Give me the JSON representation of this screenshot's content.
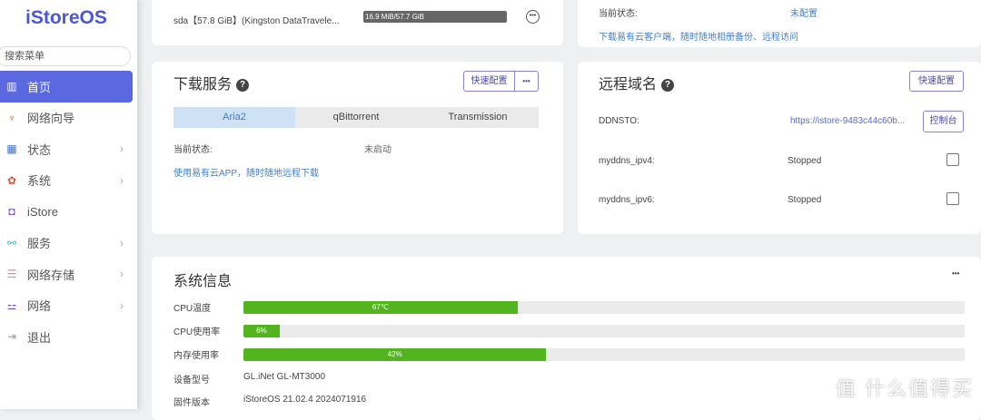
{
  "sidebar": {
    "logo": "iStoreOS",
    "search_placeholder": "搜索菜单",
    "items": [
      {
        "label": "首页",
        "icon": "home-icon",
        "glyph": "▥",
        "color": "#ffffff",
        "chev": ""
      },
      {
        "label": "网络向导",
        "icon": "wizard-icon",
        "glyph": "♆",
        "color": "#e0643b",
        "chev": ""
      },
      {
        "label": "状态",
        "icon": "status-grid-icon",
        "glyph": "▦",
        "color": "#3f6fd8",
        "chev": "›"
      },
      {
        "label": "系统",
        "icon": "gear-icon",
        "glyph": "✿",
        "color": "#e0532f",
        "chev": "›"
      },
      {
        "label": "iStore",
        "icon": "store-bag-icon",
        "glyph": "◘",
        "color": "#7a4fd6",
        "chev": ""
      },
      {
        "label": "服务",
        "icon": "service-icon",
        "glyph": "⚯",
        "color": "#3ab5e0",
        "chev": "›"
      },
      {
        "label": "网络存储",
        "icon": "storage-icon",
        "glyph": "☰",
        "color": "#e58a9a",
        "chev": "›"
      },
      {
        "label": "网络",
        "icon": "network-icon",
        "glyph": "⚍",
        "color": "#6a4fc6",
        "chev": "›"
      },
      {
        "label": "退出",
        "icon": "logout-icon",
        "glyph": "⇥",
        "color": "#999999",
        "chev": ""
      }
    ]
  },
  "disk": {
    "name": "sda【57.8 GiB】(Kingston DataTravele...",
    "usage": "16.9 MiB/57.7 GiB",
    "usage_fraction": 0.0003
  },
  "cloud": {
    "status_label": "当前状态:",
    "status_value": "未配置",
    "link": "下载易有云客户端，随时随地相册备份、远程访问"
  },
  "download": {
    "title": "下载服务",
    "quick_config": "快速配置",
    "more": "•••",
    "tabs": [
      "Aria2",
      "qBittorrent",
      "Transmission"
    ],
    "status_label": "当前状态:",
    "status_value": "未启动",
    "link": "使用易有云APP，随时随地远程下载"
  },
  "remote": {
    "title": "远程域名",
    "quick_config": "快速配置",
    "ddnsto_label": "DDNSTO:",
    "ddnsto_url": "https://istore-9483c44c60b...",
    "console": "控制台",
    "rows": [
      {
        "label": "myddns_ipv4:",
        "value": "Stopped"
      },
      {
        "label": "myddns_ipv6:",
        "value": "Stopped"
      }
    ]
  },
  "sysinfo": {
    "title": "系统信息",
    "more": "•••",
    "bars": [
      {
        "label": "CPU温度",
        "text": "67℃",
        "percent": 38
      },
      {
        "label": "CPU使用率",
        "text": "6%",
        "percent": 5
      },
      {
        "label": "内存使用率",
        "text": "42%",
        "percent": 42
      }
    ],
    "model_label": "设备型号",
    "model": "GL.iNet GL-MT3000",
    "firmware_label": "固件版本",
    "firmware": "iStoreOS 21.02.4 2024071916"
  },
  "watermark": "值 什么值得买"
}
